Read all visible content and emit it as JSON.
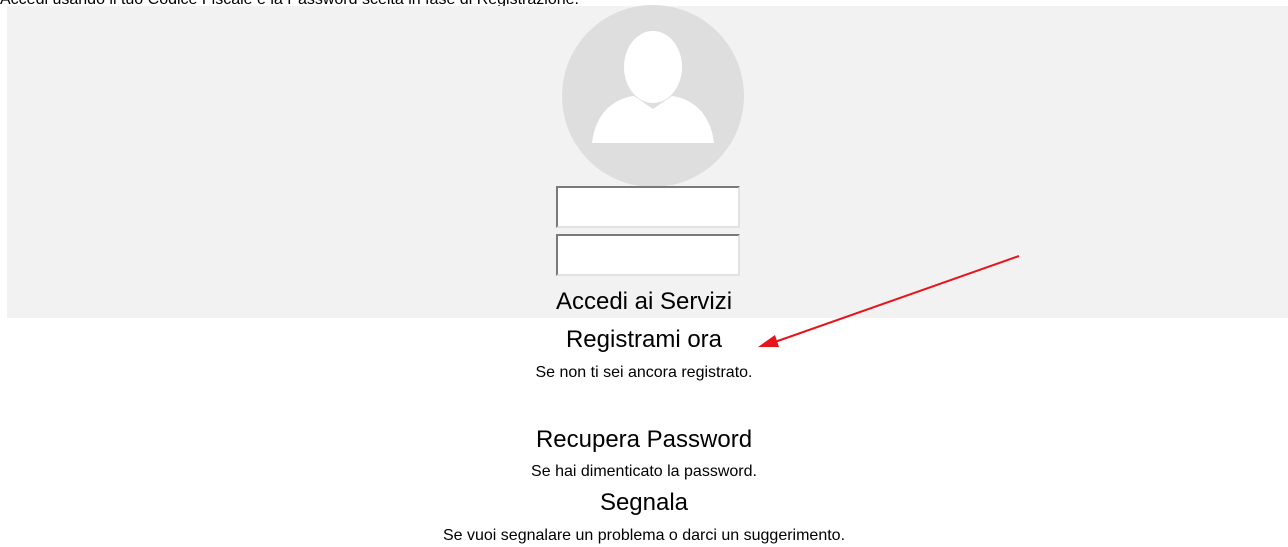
{
  "instruction": "Accedi usando il tuo Codice Fiscale e la Password scelta in fase di Registrazione.",
  "login": {
    "username_value": "",
    "password_value": ""
  },
  "links": {
    "accedi": "Accedi ai Servizi",
    "registrami": "Registrami ora",
    "registrami_desc": "Se non ti sei ancora registrato.",
    "recupera": "Recupera Password",
    "recupera_desc": "Se hai dimenticato la password.",
    "segnala": "Segnala",
    "segnala_desc": "Se vuoi segnalare un problema o darci un suggerimento."
  },
  "icons": {
    "avatar": "user-silhouette-icon",
    "annotation": "red-arrow-icon"
  },
  "colors": {
    "panel_background": "#f2f2f2",
    "avatar_background": "#dedede",
    "annotation": "#e8141c"
  }
}
